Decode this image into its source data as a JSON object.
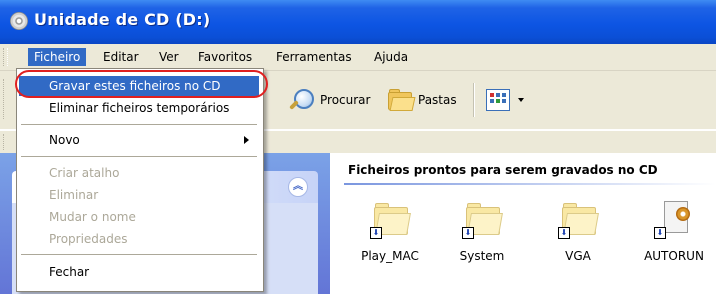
{
  "window": {
    "title": "Unidade de CD (D:)",
    "title_icon": "cd-drive-icon"
  },
  "menubar": {
    "items": [
      "Ficheiro",
      "Editar",
      "Ver",
      "Favoritos",
      "Ferramentas",
      "Ajuda"
    ],
    "open_item": "Ficheiro"
  },
  "toolbar": {
    "search_label": "Procurar",
    "folders_label": "Pastas",
    "views_icon": "views-icon"
  },
  "file_menu": {
    "items": [
      {
        "label": "Gravar estes ficheiros no CD",
        "state": "highlighted"
      },
      {
        "label": "Eliminar ficheiros temporários",
        "state": "enabled"
      },
      {
        "label": "Novo",
        "state": "enabled",
        "submenu": true
      },
      {
        "label": "Criar atalho",
        "state": "disabled"
      },
      {
        "label": "Eliminar",
        "state": "disabled"
      },
      {
        "label": "Mudar o nome",
        "state": "disabled"
      },
      {
        "label": "Propriedades",
        "state": "disabled"
      },
      {
        "label": "Fechar",
        "state": "enabled"
      }
    ],
    "highlight_color": "#316ac5",
    "annotation_color": "#e02020"
  },
  "content": {
    "section_title": "Ficheiros prontos para serem gravados no CD",
    "files": [
      {
        "name": "Play_MAC",
        "icon": "folder-icon"
      },
      {
        "name": "System",
        "icon": "folder-icon"
      },
      {
        "name": "VGA",
        "icon": "folder-icon"
      },
      {
        "name": "AUTORUN",
        "icon": "autorun-file-icon"
      }
    ]
  },
  "taskpane": {
    "collapse_icon": "chevron-up-double-icon"
  }
}
